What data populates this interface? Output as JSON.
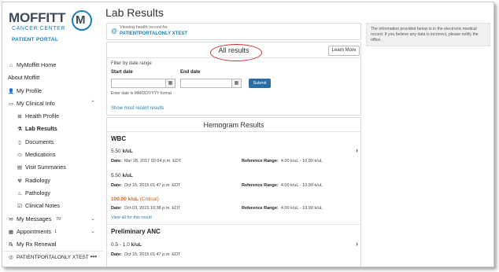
{
  "brand": {
    "name": "MOFFITT",
    "sub": "CANCER CENTER",
    "portal": "PATIENT PORTAL",
    "mark": "M"
  },
  "sidebar": {
    "items": [
      {
        "icon": "home-icon",
        "glyph": "⌂",
        "label": "MyMoffitt Home"
      },
      {
        "icon": "",
        "glyph": "",
        "label": "About Moffitt"
      },
      {
        "icon": "profile-icon",
        "glyph": "👤",
        "label": "My Profile"
      },
      {
        "icon": "folder-icon",
        "glyph": "▭",
        "label": "My Clinical Info",
        "chevron": "⌃"
      },
      {
        "icon": "health-icon",
        "glyph": "⊞",
        "label": "Health Profile"
      },
      {
        "icon": "lab-icon",
        "glyph": "⚗",
        "label": "Lab Results"
      },
      {
        "icon": "document-icon",
        "glyph": "▯",
        "label": "Documents"
      },
      {
        "icon": "medication-icon",
        "glyph": "⬭",
        "label": "Medications"
      },
      {
        "icon": "visit-icon",
        "glyph": "▤",
        "label": "Visit Summaries"
      },
      {
        "icon": "radiology-icon",
        "glyph": "☢",
        "label": "Radiology"
      },
      {
        "icon": "pathology-icon",
        "glyph": "♨",
        "label": "Pathology"
      },
      {
        "icon": "notes-icon",
        "glyph": "☑",
        "label": "Clinical Notes"
      },
      {
        "icon": "messages-icon",
        "glyph": "✉",
        "label": "My Messages",
        "count": "70",
        "chevron": "⌄"
      },
      {
        "icon": "calendar-icon",
        "glyph": "▦",
        "label": "Appointments",
        "count": "1",
        "chevron": "⌄"
      },
      {
        "icon": "rx-icon",
        "glyph": "℞",
        "label": "My Rx Renewal"
      }
    ],
    "user": {
      "glyph": "◎",
      "label": "PATIENTPORTALONLY XTEST",
      "more": "•••"
    }
  },
  "page": {
    "title": "Lab Results",
    "viewing_label": "Viewing health record for",
    "viewing_name": "PATIENTPORTALONLY XTEST",
    "at_glyph": "@"
  },
  "results": {
    "title": "All results",
    "learn_more": "Learn More",
    "filter_label": "Filter by date range",
    "start_label": "Start date",
    "end_label": "End date",
    "submit": "Submit",
    "hint": "Enter date in MM/DD/YYYY format",
    "recent_link": "Show most recent results",
    "calendar_glyph": "▦"
  },
  "hemogram": {
    "title": "Hemogram Results",
    "date_label": "Date:",
    "ref_label": "Reference Range:",
    "view_all": "View all for this result",
    "chevron": "›",
    "tests": [
      {
        "name": "WBC",
        "entries": [
          {
            "value": "5.50",
            "unit": "k/uL",
            "date": "Mar 28, 2017 02:04 p.m. EDT",
            "ref": "4.00 k/uL - 10.90 k/uL",
            "critical": false
          },
          {
            "value": "5.50",
            "unit": "k/uL",
            "date": "Oct 15, 2015 01:47 p.m. EDT",
            "ref": "4.00 k/uL - 10.90 k/uL",
            "critical": false
          },
          {
            "value": "100.00",
            "unit": "k/uL",
            "tag": "(Critical)",
            "date": "Oct 03, 2015 10:38 p.m. EDT",
            "ref": "4.00 k/uL - 10.90 k/uL",
            "critical": true
          }
        ]
      },
      {
        "name": "Preliminary ANC",
        "entries": [
          {
            "value": "0.5 - 1.0",
            "unit": "k/uL",
            "date": "Oct 15, 2015 01:47 p.m. EDT",
            "critical": false
          }
        ]
      }
    ]
  },
  "info": {
    "text": "The information provided below is in the electronic medical record. If you believe any data is incorrect, please notify the office."
  },
  "colors": {
    "brand_blue": "#1a7fb5",
    "submit_blue": "#2a6ea6",
    "critical": "#d86018",
    "highlight_ellipse": "#d0282b"
  }
}
